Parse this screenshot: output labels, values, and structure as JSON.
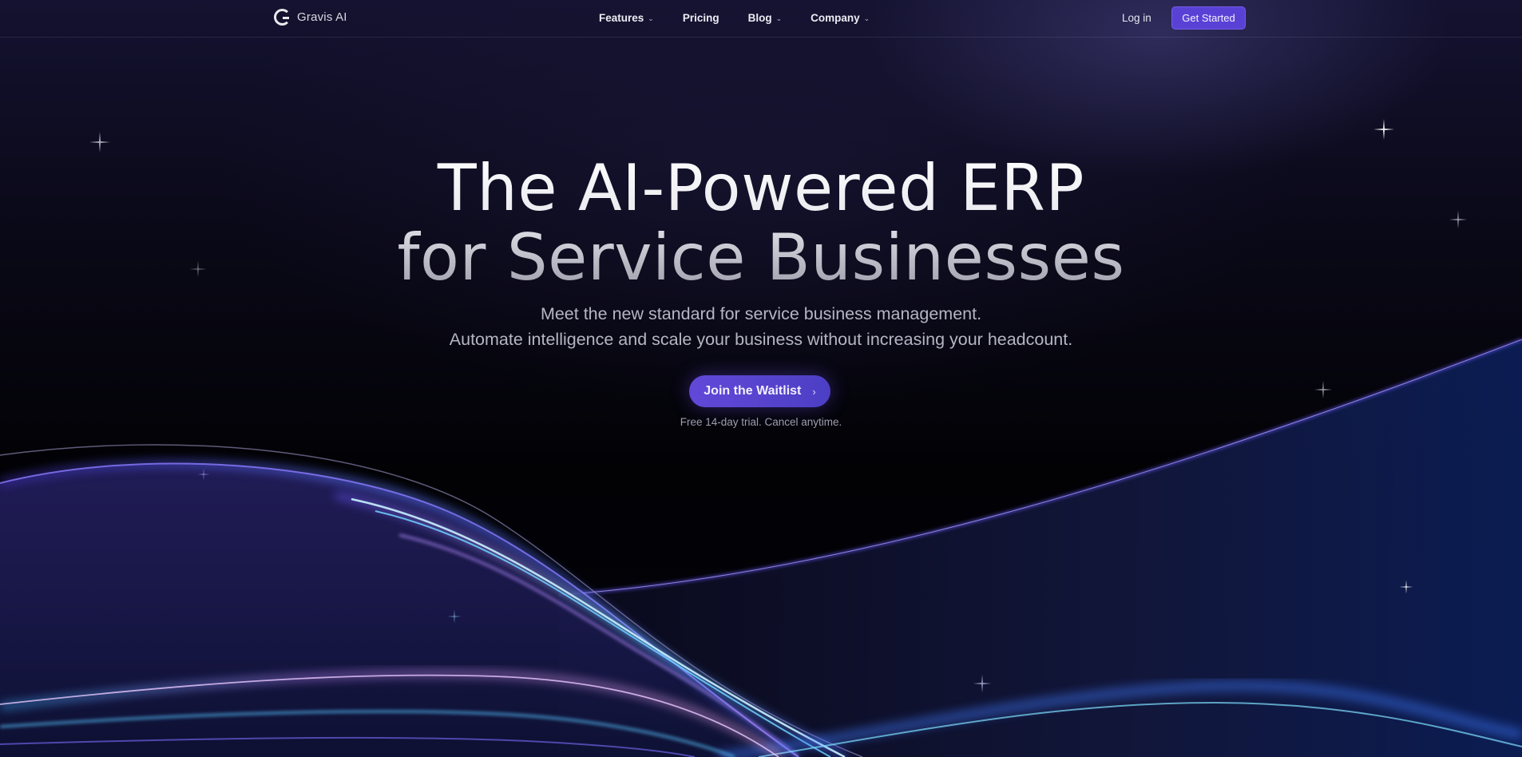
{
  "nav": {
    "logo_text": "Gravis AI",
    "links": [
      {
        "label": "Features",
        "has_dropdown": true
      },
      {
        "label": "Pricing",
        "has_dropdown": false
      },
      {
        "label": "Blog",
        "has_dropdown": true
      },
      {
        "label": "Company",
        "has_dropdown": true
      }
    ],
    "login_label": "Log in",
    "get_started_label": "Get Started"
  },
  "hero": {
    "title_line1": "The AI-Powered ERP",
    "title_line2": "for Service Businesses",
    "subtitle_line1": "Meet the new standard for service business management.",
    "subtitle_line2": "Automate intelligence and scale your business without increasing your headcount.",
    "cta_label": "Join the Waitlist",
    "cta_icon": "chevron-right-icon",
    "note": "Free 14-day trial. Cancel anytime."
  },
  "colors": {
    "accent": "#5a41d6",
    "background": "#05040d"
  }
}
